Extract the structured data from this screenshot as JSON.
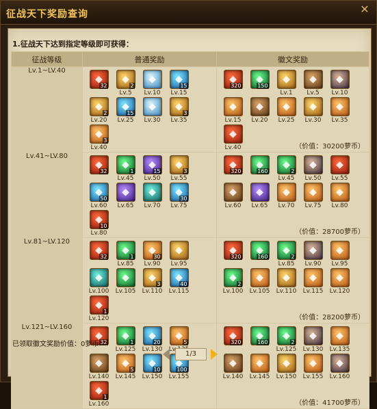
{
  "window": {
    "title": "征战天下奖励查询",
    "close_icon": "close-icon"
  },
  "heading": "1.征战天下达到指定等级即可获得：",
  "columns": {
    "level": "征战等级",
    "normal": "普通奖励",
    "badge": "徽文奖励"
  },
  "tiers": [
    {
      "level": "Lv.1~LV.40",
      "normal": [
        {
          "icon": "red-chest",
          "color": "c-red",
          "count": "32",
          "lv": ""
        },
        {
          "icon": "gold-scroll",
          "color": "c-gold",
          "count": "2",
          "lv": "Lv.5"
        },
        {
          "icon": "ice-crystal",
          "color": "c-ice",
          "count": "",
          "lv": "Lv.10"
        },
        {
          "icon": "blue-orb",
          "color": "c-blue",
          "count": "15",
          "lv": "Lv.15"
        },
        {
          "icon": "gold-book",
          "color": "c-gold",
          "count": "2",
          "lv": "Lv.20"
        },
        {
          "icon": "blue-orb",
          "color": "c-blue",
          "count": "15",
          "lv": "Lv.25"
        },
        {
          "icon": "ice-crystal",
          "color": "c-ice",
          "count": "",
          "lv": "Lv.30"
        },
        {
          "icon": "gold-scroll",
          "color": "c-gold",
          "count": "3",
          "lv": "Lv.35"
        },
        {
          "icon": "gold-book",
          "color": "c-orange",
          "count": "3",
          "lv": "Lv.40"
        }
      ],
      "badge": [
        {
          "icon": "red-chest",
          "color": "c-red",
          "count": "320",
          "lv": ""
        },
        {
          "icon": "green-gem",
          "color": "c-green",
          "count": "150",
          "lv": ""
        },
        {
          "icon": "gold-rune",
          "color": "c-gold",
          "count": "",
          "lv": "Lv.1"
        },
        {
          "icon": "gold-rune",
          "color": "c-brown",
          "count": "",
          "lv": "Lv.5"
        },
        {
          "icon": "hero-portrait",
          "color": "c-char",
          "count": "",
          "lv": "Lv.10"
        },
        {
          "icon": "gold-chest",
          "color": "c-orange",
          "count": "",
          "lv": "Lv.15"
        },
        {
          "icon": "gold-rune",
          "color": "c-brown",
          "count": "",
          "lv": "Lv.20"
        },
        {
          "icon": "gold-chest",
          "color": "c-orange",
          "count": "",
          "lv": "Lv.25"
        },
        {
          "icon": "gold-book",
          "color": "c-gold",
          "count": "",
          "lv": "Lv.30"
        },
        {
          "icon": "gold-chest",
          "color": "c-orange",
          "count": "",
          "lv": "Lv.35"
        },
        {
          "icon": "red-rune",
          "color": "c-red",
          "count": "",
          "lv": "Lv.40"
        }
      ],
      "value": "（价值：30200萝币）"
    },
    {
      "level": "Lv.41~LV.80",
      "normal": [
        {
          "icon": "red-chest",
          "color": "c-red",
          "count": "32",
          "lv": ""
        },
        {
          "icon": "green-orb",
          "color": "c-green",
          "count": "1",
          "lv": "Lv.45"
        },
        {
          "icon": "purple-crystal",
          "color": "c-purple",
          "count": "15",
          "lv": "Lv.50"
        },
        {
          "icon": "gold-scroll",
          "color": "c-gold",
          "count": "3",
          "lv": "Lv.55"
        },
        {
          "icon": "blue-orb",
          "color": "c-blue",
          "count": "50",
          "lv": "Lv.60"
        },
        {
          "icon": "purple-orb",
          "color": "c-purple",
          "count": "",
          "lv": "Lv.65"
        },
        {
          "icon": "teal-chest",
          "color": "c-teal",
          "count": "",
          "lv": "Lv.70"
        },
        {
          "icon": "blue-orb",
          "color": "c-blue",
          "count": "30",
          "lv": "Lv.75"
        },
        {
          "icon": "red-rune",
          "color": "c-red",
          "count": "10",
          "lv": "Lv.80"
        }
      ],
      "badge": [
        {
          "icon": "red-chest",
          "color": "c-red",
          "count": "320",
          "lv": ""
        },
        {
          "icon": "green-gem",
          "color": "c-green",
          "count": "160",
          "lv": ""
        },
        {
          "icon": "green-orb",
          "color": "c-green",
          "count": "2",
          "lv": "Lv.45"
        },
        {
          "icon": "hero-portrait",
          "color": "c-char",
          "count": "",
          "lv": "Lv.50"
        },
        {
          "icon": "red-rune",
          "color": "c-red",
          "count": "",
          "lv": "Lv.55"
        },
        {
          "icon": "gold-rune",
          "color": "c-brown",
          "count": "",
          "lv": "Lv.60"
        },
        {
          "icon": "purple-orb",
          "color": "c-purple",
          "count": "",
          "lv": "Lv.65"
        },
        {
          "icon": "gold-orb",
          "color": "c-orange",
          "count": "",
          "lv": "Lv.70"
        },
        {
          "icon": "gold-chest",
          "color": "c-orange",
          "count": "",
          "lv": "Lv.75"
        },
        {
          "icon": "gold-chest",
          "color": "c-orange",
          "count": "",
          "lv": "Lv.80"
        }
      ],
      "value": "（价值：28700萝币）"
    },
    {
      "level": "Lv.81~LV.120",
      "normal": [
        {
          "icon": "red-chest",
          "color": "c-red",
          "count": "32",
          "lv": ""
        },
        {
          "icon": "green-orb",
          "color": "c-green",
          "count": "1",
          "lv": "Lv.85"
        },
        {
          "icon": "red-scroll",
          "color": "c-orange",
          "count": "30",
          "lv": "Lv.90"
        },
        {
          "icon": "gold-book",
          "color": "c-gold",
          "count": "",
          "lv": "Lv.95"
        },
        {
          "icon": "teal-orb",
          "color": "c-teal",
          "count": "",
          "lv": "Lv.100"
        },
        {
          "icon": "green-tree",
          "color": "c-green",
          "count": "",
          "lv": "Lv.105"
        },
        {
          "icon": "gold-book",
          "color": "c-gold",
          "count": "3",
          "lv": "Lv.110"
        },
        {
          "icon": "blue-orb",
          "color": "c-blue",
          "count": "40",
          "lv": "Lv.115"
        },
        {
          "icon": "red-rune",
          "color": "c-red",
          "count": "1",
          "lv": "Lv.120"
        }
      ],
      "badge": [
        {
          "icon": "red-chest",
          "color": "c-red",
          "count": "320",
          "lv": ""
        },
        {
          "icon": "green-gem",
          "color": "c-green",
          "count": "160",
          "lv": ""
        },
        {
          "icon": "green-orb",
          "color": "c-green",
          "count": "2",
          "lv": "Lv.85"
        },
        {
          "icon": "hero-portrait",
          "color": "c-char",
          "count": "",
          "lv": "Lv.90"
        },
        {
          "icon": "gold-chest",
          "color": "c-orange",
          "count": "",
          "lv": "Lv.95"
        },
        {
          "icon": "green-red-badge",
          "color": "c-green",
          "count": "2",
          "lv": "Lv.100"
        },
        {
          "icon": "gold-chest",
          "color": "c-orange",
          "count": "",
          "lv": "Lv.105"
        },
        {
          "icon": "gold-book",
          "color": "c-gold",
          "count": "",
          "lv": "Lv.110"
        },
        {
          "icon": "gold-chest",
          "color": "c-orange",
          "count": "",
          "lv": "Lv.115"
        },
        {
          "icon": "gold-chest",
          "color": "c-orange",
          "count": "",
          "lv": "Lv.120"
        }
      ],
      "value": "（价值：28200萝币）"
    },
    {
      "level": "Lv.121~LV.160",
      "normal": [
        {
          "icon": "red-chest",
          "color": "c-red",
          "count": "32",
          "lv": ""
        },
        {
          "icon": "green-orb",
          "color": "c-green",
          "count": "1",
          "lv": "Lv.125"
        },
        {
          "icon": "blue-orb",
          "color": "c-blue",
          "count": "20",
          "lv": "Lv.130"
        },
        {
          "icon": "orange-orb",
          "color": "c-orange",
          "count": "5",
          "lv": "Lv.135"
        },
        {
          "icon": "gold-rune",
          "color": "c-brown",
          "count": "",
          "lv": "Lv.140"
        },
        {
          "icon": "orange-orb",
          "color": "c-orange",
          "count": "5",
          "lv": "Lv.145"
        },
        {
          "icon": "blue-orb",
          "color": "c-blue",
          "count": "10",
          "lv": "Lv.150"
        },
        {
          "icon": "blue-orb",
          "color": "c-blue",
          "count": "100",
          "lv": "Lv.155"
        },
        {
          "icon": "red-rune",
          "color": "c-red",
          "count": "1",
          "lv": "Lv.160"
        }
      ],
      "badge": [
        {
          "icon": "red-chest",
          "color": "c-red",
          "count": "320",
          "lv": ""
        },
        {
          "icon": "green-gem",
          "color": "c-green",
          "count": "160",
          "lv": ""
        },
        {
          "icon": "green-orb",
          "color": "c-green",
          "count": "2",
          "lv": "Lv.125"
        },
        {
          "icon": "spear",
          "color": "c-char",
          "count": "",
          "lv": "Lv.130"
        },
        {
          "icon": "gold-chest",
          "color": "c-orange",
          "count": "",
          "lv": "Lv.135"
        },
        {
          "icon": "gold-rune",
          "color": "c-brown",
          "count": "",
          "lv": "Lv.140"
        },
        {
          "icon": "gold-chest",
          "color": "c-orange",
          "count": "",
          "lv": "Lv.145"
        },
        {
          "icon": "gold-book",
          "color": "c-gold",
          "count": "",
          "lv": "Lv.150"
        },
        {
          "icon": "gold-chest",
          "color": "c-orange",
          "count": "",
          "lv": "Lv.155"
        },
        {
          "icon": "hero-portrait",
          "color": "c-char",
          "count": "",
          "lv": "Lv.160"
        }
      ],
      "value": "（价值：41700萝币）"
    }
  ],
  "summary": "已领取徽文奖励价值：0萝币",
  "pager": {
    "current": "1/3",
    "prev_icon": "arrow-left-icon",
    "next_icon": "arrow-right-icon"
  }
}
